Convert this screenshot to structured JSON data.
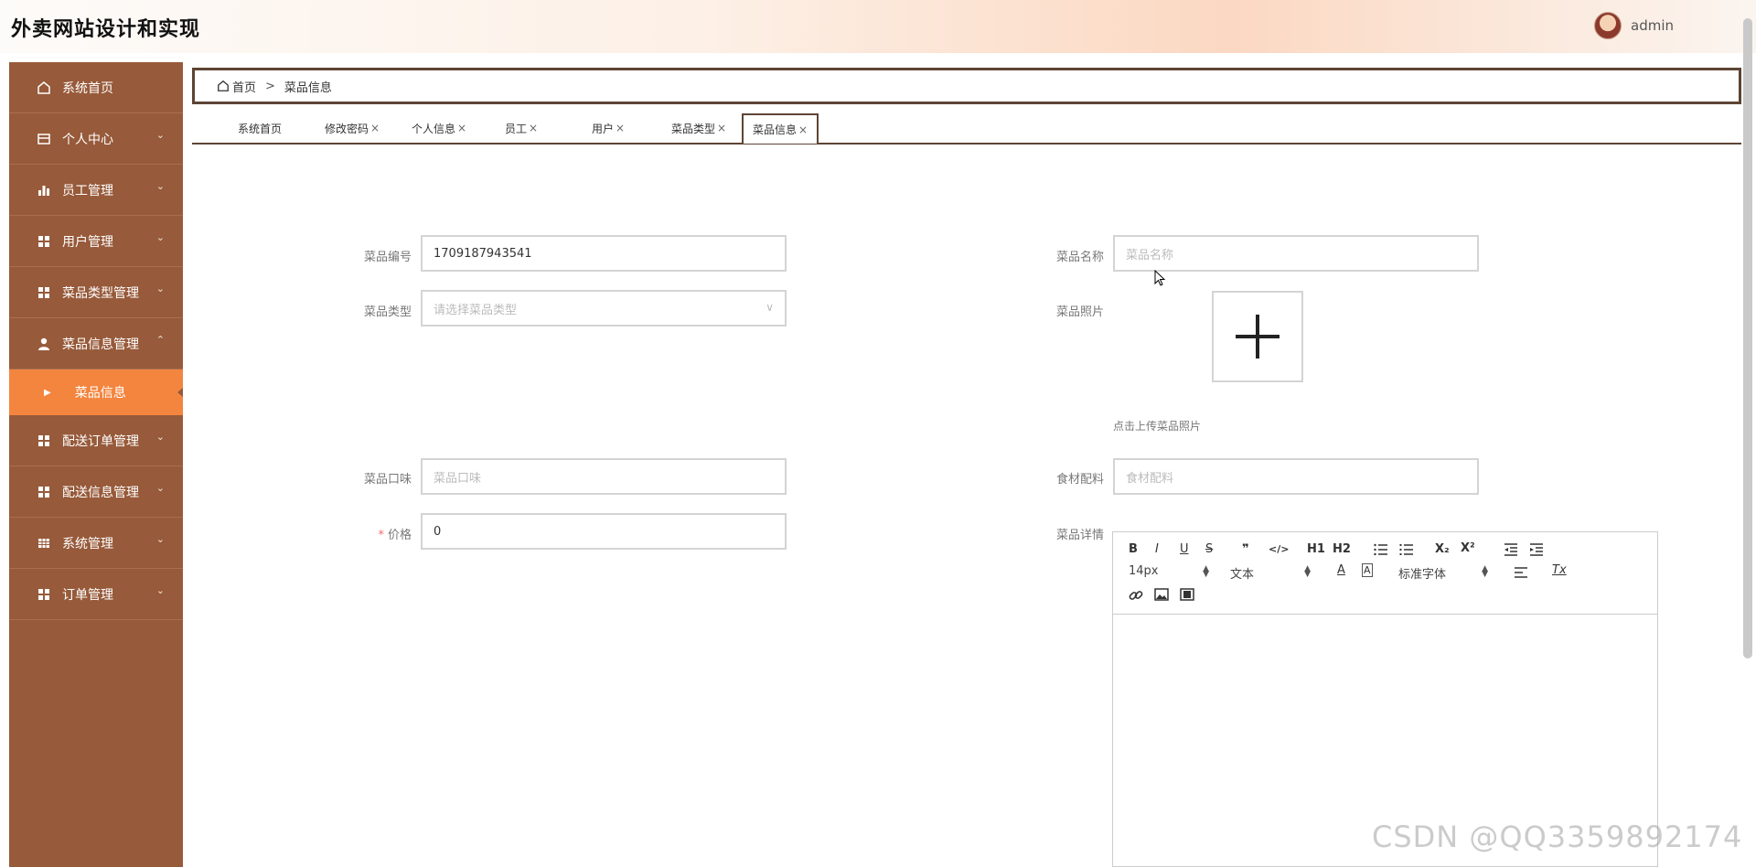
{
  "header": {
    "title": "外卖网站设计和实现",
    "user": "admin"
  },
  "sidebar": {
    "items": [
      {
        "label": "系统首页",
        "icon": "home-icon",
        "arrow": ""
      },
      {
        "label": "个人中心",
        "icon": "card-icon",
        "arrow": "⌄"
      },
      {
        "label": "员工管理",
        "icon": "bar-chart-icon",
        "arrow": "⌄"
      },
      {
        "label": "用户管理",
        "icon": "grid-icon",
        "arrow": "⌄"
      },
      {
        "label": "菜品类型管理",
        "icon": "grid-icon",
        "arrow": "⌄"
      },
      {
        "label": "菜品信息管理",
        "icon": "user-icon",
        "arrow": "⌃"
      },
      {
        "label": "配送订单管理",
        "icon": "grid-icon",
        "arrow": "⌄"
      },
      {
        "label": "配送信息管理",
        "icon": "grid-icon",
        "arrow": "⌄"
      },
      {
        "label": "系统管理",
        "icon": "table-icon",
        "arrow": "⌄"
      },
      {
        "label": "订单管理",
        "icon": "grid-icon",
        "arrow": "⌄"
      }
    ],
    "submenu": {
      "label": "菜品信息"
    }
  },
  "breadcrumb": {
    "home": "首页",
    "separator": ">",
    "current": "菜品信息"
  },
  "tabs": [
    {
      "label": "系统首页",
      "close": ""
    },
    {
      "label": "修改密码",
      "close": "×"
    },
    {
      "label": "个人信息",
      "close": "×"
    },
    {
      "label": "员工",
      "close": "×"
    },
    {
      "label": "用户",
      "close": "×"
    },
    {
      "label": "菜品类型",
      "close": "×"
    },
    {
      "label": "菜品信息",
      "close": "×"
    }
  ],
  "form": {
    "dish_no": {
      "label": "菜品编号",
      "value": "1709187943541"
    },
    "dish_name": {
      "label": "菜品名称",
      "placeholder": "菜品名称"
    },
    "dish_type": {
      "label": "菜品类型",
      "placeholder": "请选择菜品类型"
    },
    "dish_photo": {
      "label": "菜品照片",
      "hint": "点击上传菜品照片"
    },
    "flavor": {
      "label": "菜品口味",
      "placeholder": "菜品口味"
    },
    "ingredients": {
      "label": "食材配料",
      "placeholder": "食材配料"
    },
    "price": {
      "required": "*",
      "label": "价格",
      "value": "0"
    },
    "details": {
      "label": "菜品详情"
    }
  },
  "editor": {
    "font_size": "14px",
    "text_type": "文本",
    "font_family": "标准字体",
    "buttons": [
      "B",
      "I",
      "U",
      "S",
      "❞",
      "</>",
      "H1",
      "H2",
      "ordered-list",
      "bullet-list",
      "X₂",
      "X²",
      "outdent",
      "indent",
      "A",
      "A",
      "align",
      "Tx",
      "link",
      "image",
      "video"
    ]
  },
  "watermark": "CSDN @QQ3359892174"
}
